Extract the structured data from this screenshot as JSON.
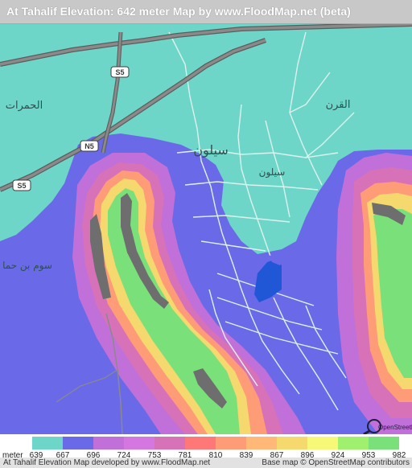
{
  "title": "At Tahalif Elevation: 642 meter Map by www.FloodMap.net (beta)",
  "map": {
    "places": {
      "siloun_main": "سيلون",
      "siloun_small": "سيلون",
      "al_humrat": "الحمرات",
      "al_qarn": "القرن",
      "sawm_bin_hammad": "سوم بن حما"
    },
    "roads": {
      "n5": "N5",
      "s5_north": "S5",
      "s5_west": "S5"
    },
    "osm_logo": "OpenStreetMap",
    "colors": {
      "background": "#6ed6c8",
      "road": "#8a8a8a",
      "road_outline": "#5c5c5c",
      "local_road": "#dcf2ee",
      "lake_dark": "#1f57d6"
    }
  },
  "legend": {
    "unit": "meter",
    "ticks": [
      "639",
      "667",
      "696",
      "724",
      "753",
      "781",
      "810",
      "839",
      "867",
      "896",
      "924",
      "953",
      "982"
    ],
    "colors": [
      "#6ed6c8",
      "#6a6ae8",
      "#c070d8",
      "#d477e0",
      "#d872b8",
      "#ff7878",
      "#ff9c78",
      "#ffb878",
      "#f5d86e",
      "#f8f878",
      "#a0f070",
      "#7ae07a"
    ]
  },
  "footer": {
    "credit": "At Tahalif Elevation Map developed by www.FloodMap.net",
    "basemap": "Base map © OpenStreetMap contributors"
  }
}
